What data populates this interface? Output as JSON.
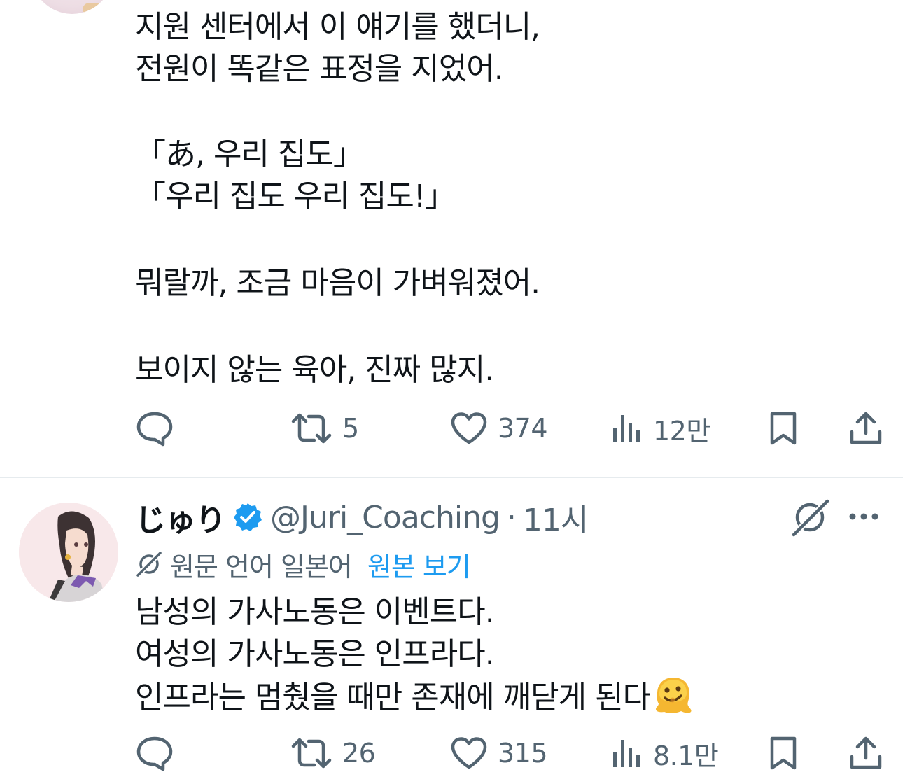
{
  "post1": {
    "lines": [
      "지원 센터에서 이 얘기를 했더니,",
      "전원이 똑같은 표정을 지었어.",
      "「あ, 우리 집도」",
      "「우리 집도 우리 집도!」",
      "뭐랄까, 조금 마음이 가벼워졌어.",
      "보이지 않는 육아, 진짜 많지."
    ],
    "actions": {
      "reply_icon": "reply-icon",
      "retweet_count": "5",
      "like_count": "374",
      "views_count": "12만",
      "bookmark_icon": "bookmark-icon",
      "share_icon": "share-icon"
    }
  },
  "post2": {
    "display_name": "じゅり",
    "verified_icon": "verified-badge-icon",
    "handle": "@Juri_Coaching",
    "separator": "·",
    "time": "11시",
    "grok_icon": "grok-icon",
    "more_icon": "more-icon",
    "translation": {
      "label": "원문 언어 일본어",
      "link": "원본 보기"
    },
    "lines": [
      "남성의 가사노동은 이벤트다.",
      "여성의 가사노동은 인프라다.",
      "인프라는 멈췄을 때만 존재에 깨닫게 된다"
    ],
    "emoji": "melting-face-emoji",
    "actions": {
      "retweet_count": "26",
      "like_count": "315",
      "views_count": "8.1만"
    }
  },
  "colors": {
    "text": "#0f1419",
    "secondary": "#536471",
    "link": "#1d9bf0",
    "verified": "#1d9bf0",
    "divider": "#e6ebee"
  }
}
